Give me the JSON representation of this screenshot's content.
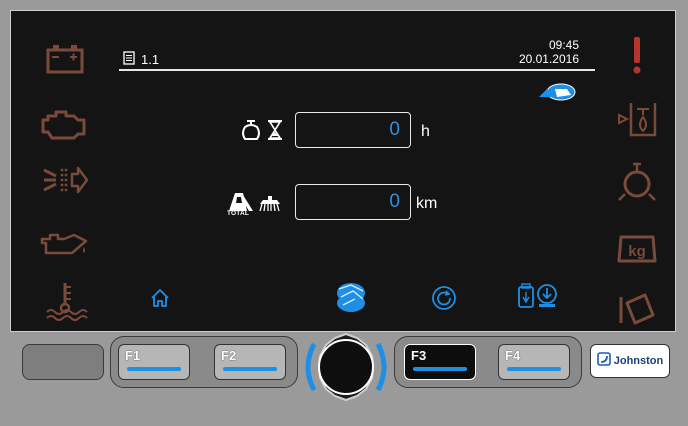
{
  "header": {
    "page_number": "1.1",
    "time": "09:45",
    "date": "20.01.2016"
  },
  "left_icons": [
    "battery-warning-icon",
    "engine-warning-icon",
    "air-filter-warning-icon",
    "oil-pressure-warning-icon",
    "coolant-temperature-warning-icon"
  ],
  "right_icons": [
    "general-warning-icon",
    "hydraulic-filter-warning-icon",
    "suction-fan-warning-icon",
    "overload-kg-icon",
    "hopper-tilt-icon"
  ],
  "counters": {
    "engine_hours": {
      "value": "0",
      "unit": "h"
    },
    "distance": {
      "value": "0",
      "unit": "km",
      "icon_caption": "TOTAL"
    }
  },
  "softkeys": [
    {
      "label": "F1"
    },
    {
      "label": "F2"
    },
    {
      "label": "F3"
    },
    {
      "label": "F4"
    }
  ],
  "brand": "Johnston",
  "colors": {
    "accent_blue": "#1d8fe6",
    "warning_brown": "#7a4a3a",
    "warning_red": "#b8332b",
    "screen_bg": "#141414"
  }
}
